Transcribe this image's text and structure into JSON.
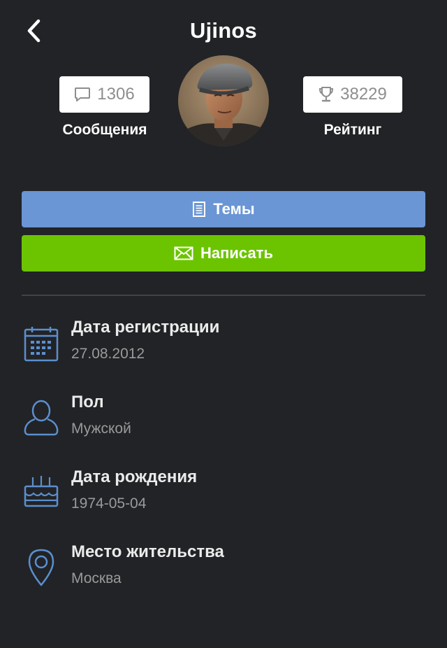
{
  "header": {
    "title": "Ujinos"
  },
  "stats": {
    "messages": {
      "count": "1306",
      "label": "Сообщения"
    },
    "rating": {
      "count": "38229",
      "label": "Рейтинг"
    }
  },
  "actions": {
    "topics_label": "Темы",
    "write_label": "Написать"
  },
  "info": [
    {
      "label": "Дата регистрации",
      "value": "27.08.2012",
      "icon": "calendar-icon"
    },
    {
      "label": "Пол",
      "value": "Мужской",
      "icon": "person-icon"
    },
    {
      "label": "Дата рождения",
      "value": "1974-05-04",
      "icon": "birthday-cake-icon"
    },
    {
      "label": "Место жительства",
      "value": "Москва",
      "icon": "location-pin-icon"
    }
  ],
  "colors": {
    "background": "#222326",
    "topics_button": "#6a96d5",
    "write_button": "#6cc400",
    "icon_accent": "#5b8fcf"
  }
}
